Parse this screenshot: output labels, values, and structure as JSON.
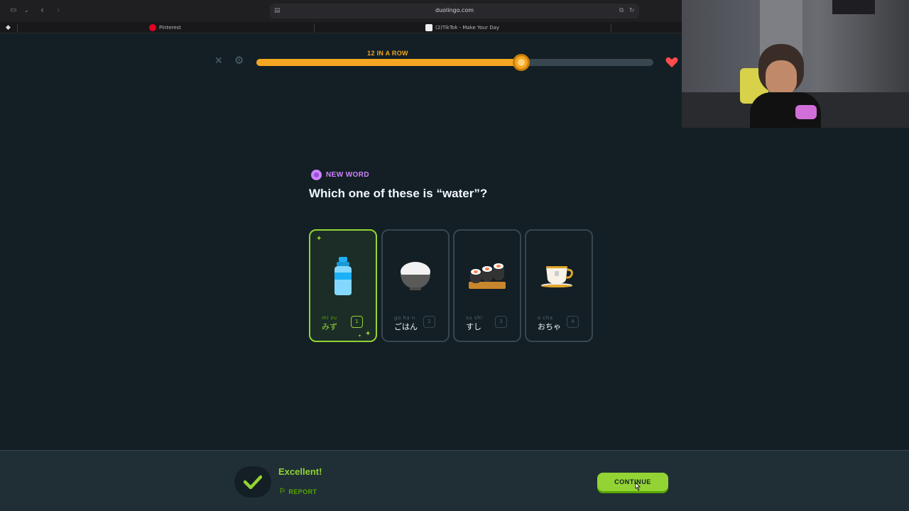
{
  "browser": {
    "url": "duolingo.com",
    "tabs": [
      {
        "label": "Pinterest"
      },
      {
        "label": "(2)TikTok - Make Your Day"
      }
    ]
  },
  "lesson": {
    "streak_label": "12 IN A ROW",
    "progress_fraction": 0.67,
    "badge_label": "NEW WORD",
    "question": "Which one of these is “water”?",
    "options": [
      {
        "romaji": "mi zu",
        "kana": "みず",
        "key": "1",
        "image": "water-bottle-icon",
        "selected": true
      },
      {
        "romaji": "go ha n",
        "kana": "ごはん",
        "key": "2",
        "image": "rice-bowl-icon",
        "selected": false
      },
      {
        "romaji": "su shi",
        "kana": "すし",
        "key": "3",
        "image": "sushi-icon",
        "selected": false
      },
      {
        "romaji": "o  cha",
        "kana": "おちゃ",
        "key": "4",
        "image": "tea-cup-icon",
        "selected": false
      }
    ]
  },
  "footer": {
    "result_text": "Excellent!",
    "report_label": "REPORT",
    "continue_label": "CONTINUE"
  },
  "colors": {
    "accent_green": "#93d333",
    "streak_orange": "#f5a623",
    "badge_purple": "#ce82ff",
    "background": "#131f24"
  }
}
